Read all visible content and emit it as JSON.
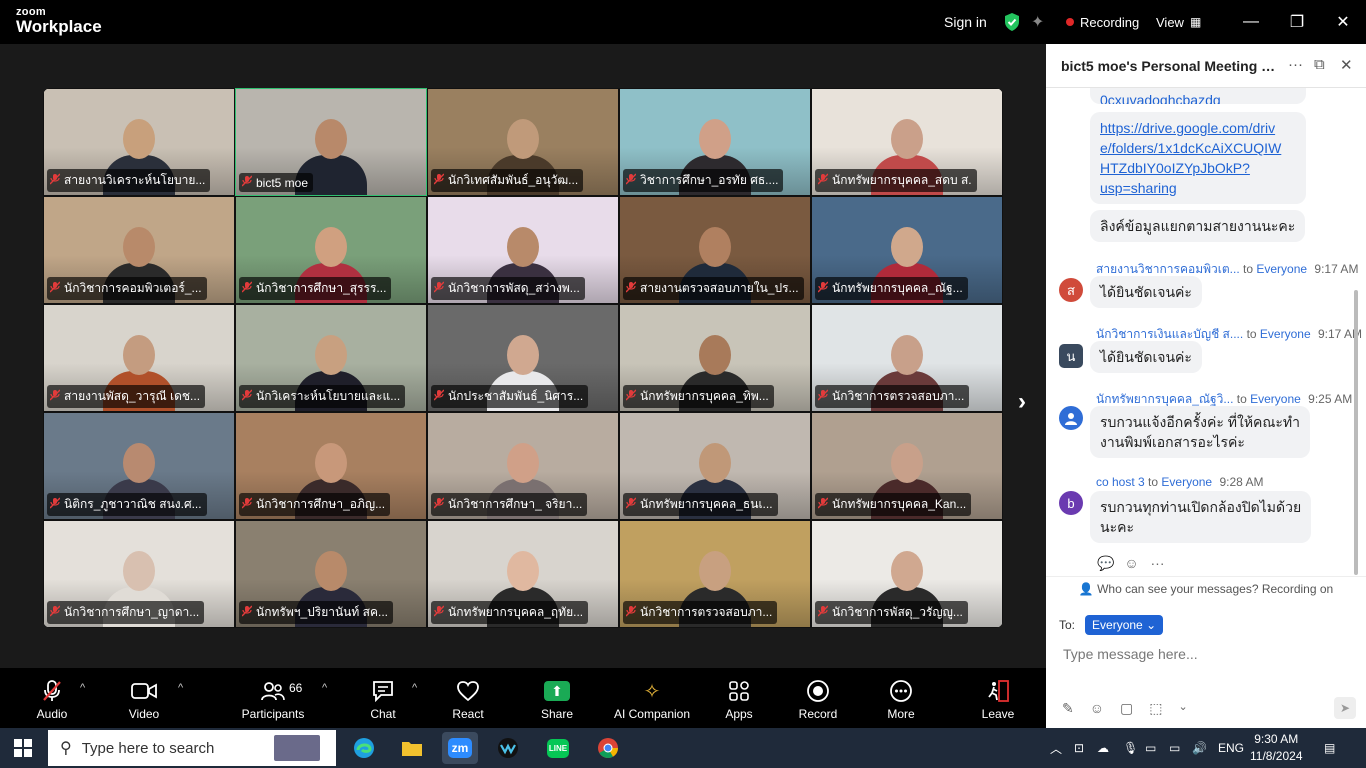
{
  "titlebar": {
    "logo_line1": "zoom",
    "logo_line2": "Workplace",
    "sign_in": "Sign in",
    "recording": "Recording",
    "view": "View"
  },
  "tiles": [
    {
      "name": "สายงานวิเคราะห์นโยบาย...",
      "bg": "#c9c0b4",
      "skin": "#c8a07c",
      "shirt": "#2a2f3a",
      "active": false
    },
    {
      "name": "bict5 moe",
      "bg": "#b9b5ae",
      "skin": "#b8896a",
      "shirt": "#1f2430",
      "active": true
    },
    {
      "name": "นักวิเทศสัมพันธ์_อนุวัฒ...",
      "bg": "#9a8060",
      "skin": "#c09a7a",
      "shirt": "#4a3a2a",
      "active": false
    },
    {
      "name": "วิชาการศึกษา_อรทัย ศธ....",
      "bg": "#8fc0c8",
      "skin": "#d0a088",
      "shirt": "#2d2a2e",
      "active": false
    },
    {
      "name": "นักทรัพยากรบุคคล_สดบ ส.",
      "bg": "#e8e2da",
      "skin": "#caa08a",
      "shirt": "#c04a4a",
      "active": false
    },
    {
      "name": "นักวิชาการคอมพิวเตอร์_...",
      "bg": "#c0a688",
      "skin": "#b88a6a",
      "shirt": "#2a2a2a",
      "active": false
    },
    {
      "name": "นักวิชาการศึกษา_สุรรร...",
      "bg": "#7aa07a",
      "skin": "#d0a080",
      "shirt": "#b03040",
      "active": false
    },
    {
      "name": "นักวิชาการพัสดุ_สว่างพ...",
      "bg": "#e8dcea",
      "skin": "#b88a6a",
      "shirt": "#3a3040",
      "active": false
    },
    {
      "name": "สายงานตรวจสอบภายใน_ปร...",
      "bg": "#7a5a40",
      "skin": "#b08060",
      "shirt": "#1f2a3a",
      "active": false
    },
    {
      "name": "นักทรัพยากรบุคคล_ณัฐ...",
      "bg": "#4a6a8a",
      "skin": "#d0a88c",
      "shirt": "#b02a3a",
      "active": false
    },
    {
      "name": "สายงานพัสดุ_วารุณี เดช...",
      "bg": "#d8d4cc",
      "skin": "#c49c80",
      "shirt": "#b0502a",
      "active": false
    },
    {
      "name": "นักวิเคราะห์นโยบายและแ...",
      "bg": "#a8b0a0",
      "skin": "#c8a080",
      "shirt": "#1f1f2a",
      "active": false
    },
    {
      "name": "นักประชาสัมพันธ์_นิศาร...",
      "bg": "#6a6a6a",
      "skin": "#d0a890",
      "shirt": "#e8e8ea",
      "active": false
    },
    {
      "name": "นักทรัพยากรบุคคล_ทิพ...",
      "bg": "#c8c4b8",
      "skin": "#a87a5a",
      "shirt": "#2a2a2a",
      "active": false
    },
    {
      "name": "นักวิชาการตรวจสอบภา...",
      "bg": "#e0e4e6",
      "skin": "#c8a08a",
      "shirt": "#6a3a3a",
      "active": false
    },
    {
      "name": "นิติกร_ภูชาวาณิช สนง.ศ...",
      "bg": "#6a7a8a",
      "skin": "#b88a70",
      "shirt": "#3a3a4a",
      "active": false
    },
    {
      "name": "นักวิชาการศึกษา_อภิญ...",
      "bg": "#a88060",
      "skin": "#c8987a",
      "shirt": "#3a2a2a",
      "active": false
    },
    {
      "name": "นักวิชาการศึกษา_ จริยา...",
      "bg": "#b8aca0",
      "skin": "#d0a088",
      "shirt": "#7a7070",
      "active": false
    },
    {
      "name": "นักทรัพยากรบุคคล_ธนเ...",
      "bg": "#c0b8b0",
      "skin": "#c09878",
      "shirt": "#2a3040",
      "active": false
    },
    {
      "name": "นักทรัพยากรบุคคล_Kan...",
      "bg": "#b0a090",
      "skin": "#c8a08a",
      "shirt": "#4a2a2a",
      "active": false
    },
    {
      "name": "นักวิชาการศึกษา_ญาดา...",
      "bg": "#e4e0da",
      "skin": "#d8c0b0",
      "shirt": "#e0dcd6",
      "active": false
    },
    {
      "name": "นักทรัพฯ_ปริยานันท์ สค...",
      "bg": "#8a8070",
      "skin": "#b88a6a",
      "shirt": "#2a2a3a",
      "active": false
    },
    {
      "name": "นักทรัพยากรบุคคล_ฤทัย...",
      "bg": "#d8d4ce",
      "skin": "#e0b8a0",
      "shirt": "#2a2a2a",
      "active": false
    },
    {
      "name": "นักวิชาการตรวจสอบภา...",
      "bg": "#c0a060",
      "skin": "#c8a080",
      "shirt": "#2a2a2a",
      "active": false
    },
    {
      "name": "นักวิชาการพัสดุ_วรัญญู...",
      "bg": "#eceae6",
      "skin": "#d0a890",
      "shirt": "#2a2a2a",
      "active": false
    }
  ],
  "toolbar": {
    "audio": "Audio",
    "video": "Video",
    "participants": "Participants",
    "participants_count": "66",
    "chat": "Chat",
    "react": "React",
    "share": "Share",
    "ai": "AI Companion",
    "apps": "Apps",
    "record": "Record",
    "more": "More",
    "leave": "Leave"
  },
  "chat": {
    "title": "bict5 moe's Personal Meeting Ro...",
    "partial_link": "0cxuvadoqhcbazdg",
    "link": "https://drive.google.com/drive/folders/1x1dcKcAiXCUQIWHTZdbIY0oIZYpJbOkP?usp=sharing",
    "link_l1": "https://drive.google.com/driv",
    "link_l2": "e/folders/1x1dcKcAiXCUQIW",
    "link_l3": "HTZdbIY0oIZYpJbOkP?",
    "link_l4": "usp=sharing",
    "msg1": "ลิงค์ข้อมูลแยกตามสายงานนะคะ",
    "m2_sender": "สายงานวิชาการคอมพิวเต...",
    "m2_to": "to",
    "m2_recipient": "Everyone",
    "m2_time": "9:17 AM",
    "m2_avatar": "ส",
    "m2_text": "ได้ยินชัดเจนค่ะ",
    "m3_sender": "นักวิชาการเงินและบัญชี ส....",
    "m3_to": "to",
    "m3_recipient": "Everyone",
    "m3_time": "9:17 AM",
    "m3_avatar": "น",
    "m3_text": "ได้ยินชัดเจนค่ะ",
    "m4_sender": "นักทรัพยากรบุคคล_ณัฐวิ...",
    "m4_to": "to",
    "m4_recipient": "Everyone",
    "m4_time": "9:25 AM",
    "m4_l1": "รบกวนแจ้งอีกครั้งค่ะ ที่ให้คณะทำ",
    "m4_l2": "งานพิมพ์เอกสารอะไรค่ะ",
    "m5_sender": "co host 3",
    "m5_to": "to",
    "m5_recipient": "Everyone",
    "m5_time": "9:28 AM",
    "m5_avatar": "b",
    "m5_l1": "รบกวนทุกท่านเปิดกล้องปิดไมด้วย",
    "m5_l2": "นะคะ",
    "who_can_see": "Who can see your messages? Recording on",
    "to_label": "To:",
    "to_value": "Everyone",
    "placeholder": "Type message here..."
  },
  "taskbar": {
    "search": "Type here to search",
    "zoom_label": "zm",
    "line_label": "LINE",
    "lang": "ENG",
    "time": "9:30 AM",
    "date": "11/8/2024"
  },
  "colors": {
    "accent": "#1f63d4",
    "recording": "#e02828",
    "share": "#1aaa55",
    "leave": "#e03030",
    "active_tile": "#30c070"
  }
}
